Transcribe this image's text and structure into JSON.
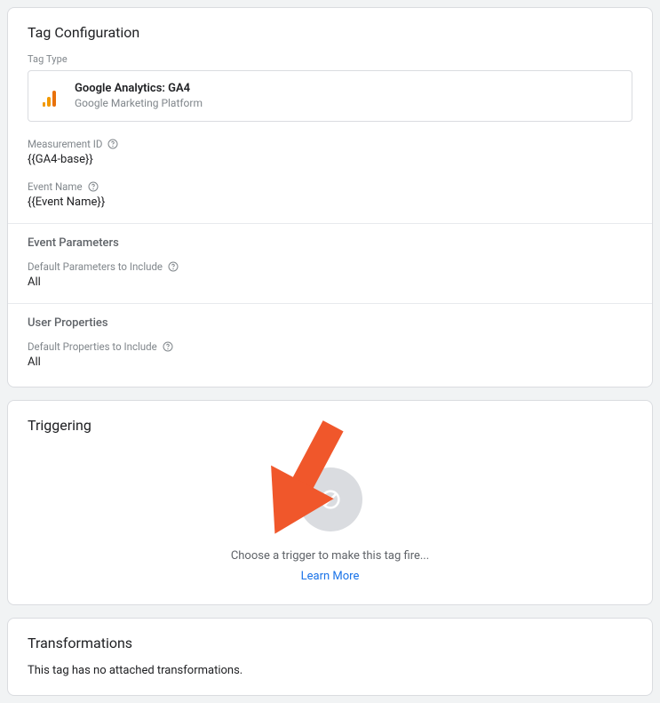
{
  "tagConfig": {
    "title": "Tag Configuration",
    "tagTypeLabel": "Tag Type",
    "tagTypeName": "Google Analytics: GA4",
    "tagTypePlatform": "Google Marketing Platform",
    "measurementIdLabel": "Measurement ID",
    "measurementIdValue": "{{GA4-base}}",
    "eventNameLabel": "Event Name",
    "eventNameValue": "{{Event Name}}",
    "eventParamsTitle": "Event Parameters",
    "defaultParamsLabel": "Default Parameters to Include",
    "defaultParamsValue": "All",
    "userPropsTitle": "User Properties",
    "defaultPropsLabel": "Default Properties to Include",
    "defaultPropsValue": "All"
  },
  "triggering": {
    "title": "Triggering",
    "emptyText": "Choose a trigger to make this tag fire...",
    "learnMore": "Learn More"
  },
  "transformations": {
    "title": "Transformations",
    "emptyText": "This tag has no attached transformations."
  }
}
